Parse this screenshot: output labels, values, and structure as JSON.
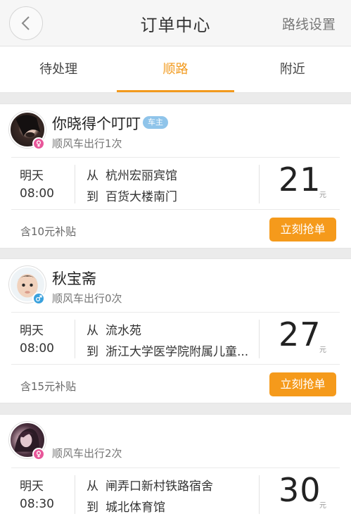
{
  "header": {
    "title": "订单中心",
    "route_settings": "路线设置"
  },
  "tabs": [
    {
      "label": "待处理"
    },
    {
      "label": "顺路",
      "active": true
    },
    {
      "label": "附近"
    }
  ],
  "colors": {
    "accent": "#f29a1e",
    "button": "#f59a1b",
    "female": "#e8579a",
    "male": "#3aa1dd",
    "owner_tag": "#8fc4ea"
  },
  "orders": [
    {
      "nickname": "你晓得个叮叮",
      "owner_tag": "车主",
      "gender": "female",
      "trip_count": "顺风车出行1次",
      "day": "明天",
      "time": "08:00",
      "from_kw": "从",
      "from": "杭州宏丽宾馆",
      "to_kw": "到",
      "to": "百货大楼南门",
      "price": "21",
      "unit": "元",
      "subsidy": "含10元补贴",
      "button": "立刻抢单"
    },
    {
      "nickname": "秋宝斋",
      "gender": "male",
      "trip_count": "顺风车出行0次",
      "day": "明天",
      "time": "08:00",
      "from_kw": "从",
      "from": "流水苑",
      "to_kw": "到",
      "to": "浙江大学医学院附属儿童...",
      "price": "27",
      "unit": "元",
      "subsidy": "含15元补贴",
      "button": "立刻抢单"
    },
    {
      "nickname": "",
      "gender": "female",
      "trip_count": "顺风车出行2次",
      "day": "明天",
      "time": "08:30",
      "from_kw": "从",
      "from": "闸弄口新村铁路宿舍",
      "to_kw": "到",
      "to": "城北体育馆",
      "price": "30",
      "unit": "元"
    }
  ]
}
